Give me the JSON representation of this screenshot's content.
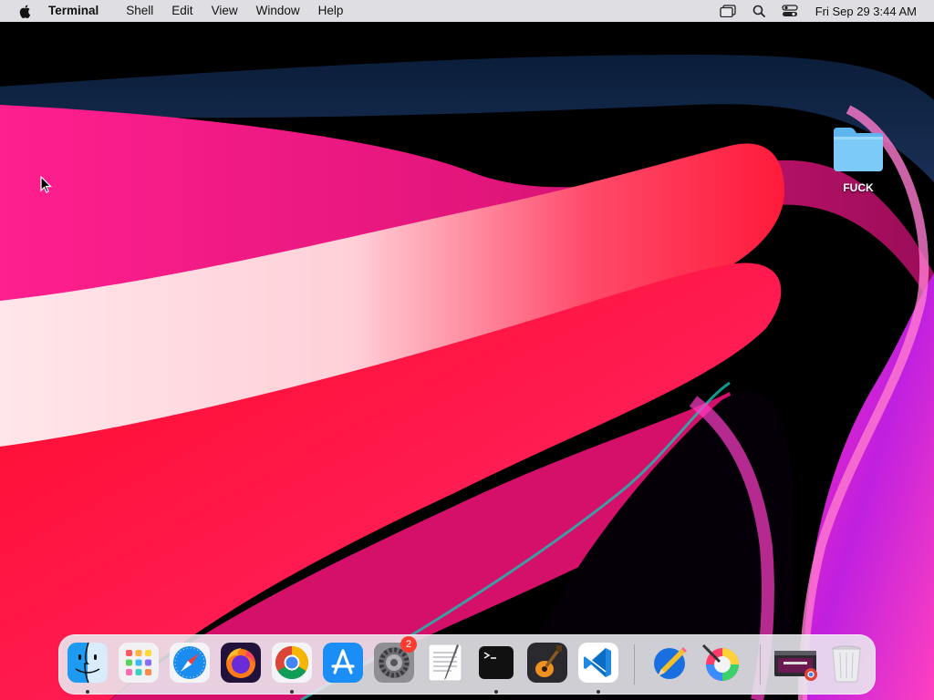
{
  "menubar": {
    "app_name": "Terminal",
    "menus": [
      "Shell",
      "Edit",
      "View",
      "Window",
      "Help"
    ],
    "clock": "Fri Sep 29  3:44 AM",
    "status_icons": [
      "display-icon",
      "search-icon",
      "control-center-icon"
    ]
  },
  "desktop": {
    "folder_label": "FUCK"
  },
  "dock": {
    "apps": [
      {
        "name": "Finder",
        "running": true
      },
      {
        "name": "Launchpad",
        "running": false
      },
      {
        "name": "Safari",
        "running": false
      },
      {
        "name": "Firefox",
        "running": false
      },
      {
        "name": "Google Chrome",
        "running": true
      },
      {
        "name": "App Store",
        "running": false
      },
      {
        "name": "System Settings",
        "running": false,
        "badge": "2"
      },
      {
        "name": "TextEdit",
        "running": false
      },
      {
        "name": "Terminal",
        "running": true
      },
      {
        "name": "GarageBand",
        "running": false
      },
      {
        "name": "Visual Studio Code",
        "running": true
      },
      {
        "name": "Pencil",
        "running": false
      },
      {
        "name": "Color Picker",
        "running": false
      },
      {
        "name": "Chrome window",
        "running": false
      },
      {
        "name": "Trash",
        "running": false
      }
    ]
  }
}
